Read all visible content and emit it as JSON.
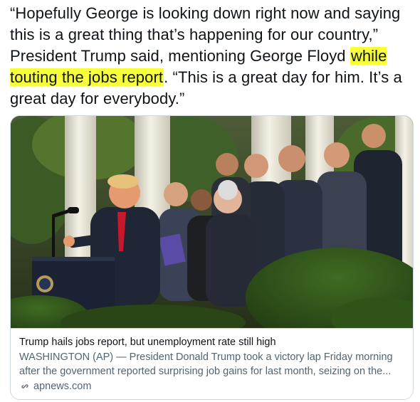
{
  "tweet": {
    "text_before_highlight": "“Hopefully George is looking down right now and saying this is a great thing that’s happening for our country,”  President Trump said, mentioning George Floyd ",
    "highlight": "while touting the jobs report",
    "text_after_highlight": ". “This is a great day for him. It’s a great day for everybody.”",
    "highlight_color": "#f6ff3a"
  },
  "card": {
    "image_icon": "news-photo",
    "title": "Trump hails jobs report, but unemployment rate still high",
    "description": "WASHINGTON (AP) — President Donald Trump took a victory lap Friday morning after the government reported surprising job gains for last month, seizing on the...",
    "domain": "apnews.com",
    "domain_icon": "link-icon"
  },
  "colors": {
    "text": "#0f1419",
    "secondary": "#536471",
    "border": "#cfd9de"
  }
}
